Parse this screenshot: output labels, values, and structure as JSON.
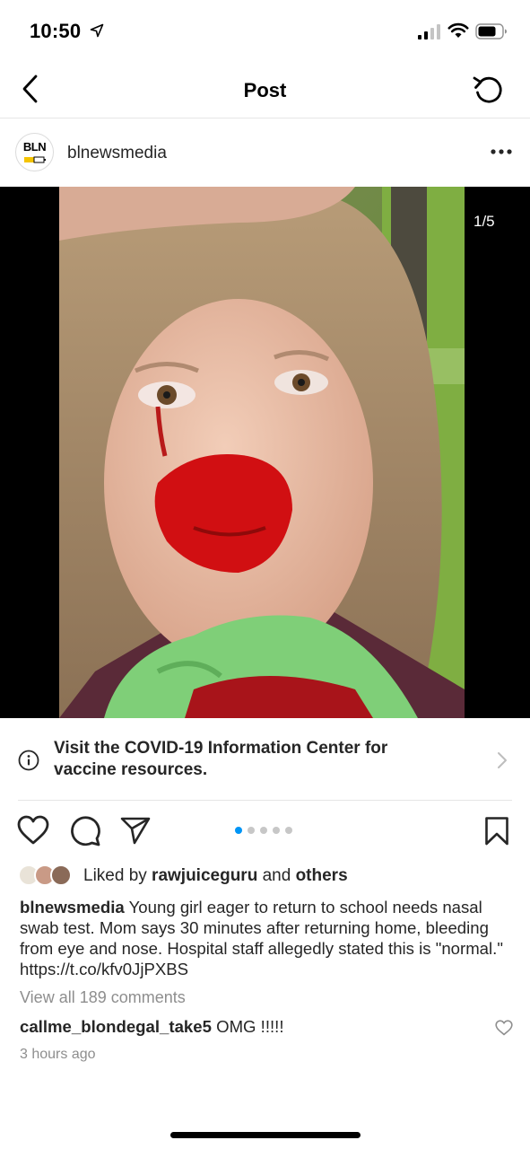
{
  "status_bar": {
    "time": "10:50"
  },
  "nav": {
    "title": "Post",
    "back_icon": "chevron-left-icon",
    "refresh_icon": "refresh-icon"
  },
  "post": {
    "avatar_text": "BLN",
    "username": "blnewsmedia",
    "image_counter": "1/5",
    "carousel_total": 5,
    "carousel_active": 1
  },
  "covid_banner": {
    "text": "Visit the COVID-19 Information Center for vaccine resources."
  },
  "likes": {
    "prefix": "Liked by ",
    "user": "rawjuiceguru",
    "middle": " and ",
    "suffix": "others"
  },
  "caption": {
    "username": "blnewsmedia",
    "text": " Young girl eager to return to school needs nasal swab test. Mom says 30 minutes after returning home, bleeding from eye and nose. Hospital staff allegedly stated this is \"normal.\" https://t.co/kfv0JjPXBS"
  },
  "comments": {
    "view_all": "View all 189 comments",
    "first": {
      "username": "callme_blondegal_take5",
      "text": " OMG !!!!!"
    }
  },
  "timestamp": "3 hours ago",
  "colors": {
    "text": "#262626",
    "muted": "#8e8e8e",
    "accent": "#0095f6",
    "divider": "#e6e6e6"
  }
}
